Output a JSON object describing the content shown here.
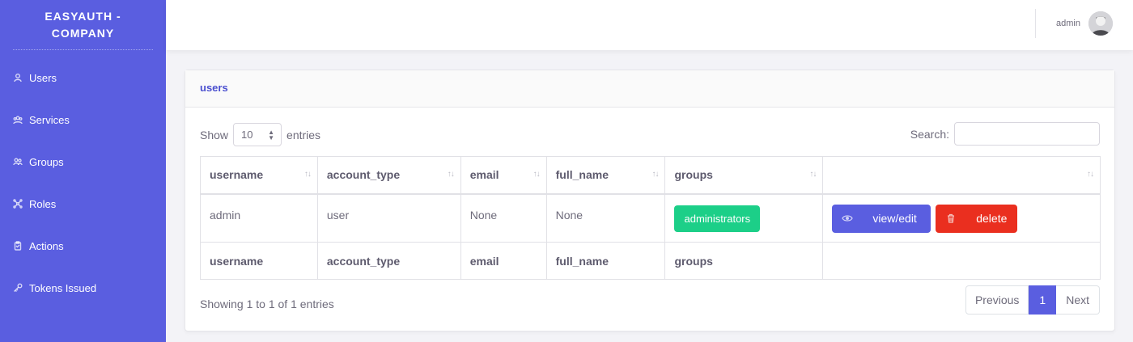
{
  "sidebar": {
    "brand": "EASYAUTH - COMPANY",
    "items": [
      {
        "label": "Users",
        "icon": "user-icon"
      },
      {
        "label": "Services",
        "icon": "services-icon"
      },
      {
        "label": "Groups",
        "icon": "groups-icon"
      },
      {
        "label": "Roles",
        "icon": "roles-icon"
      },
      {
        "label": "Actions",
        "icon": "actions-icon"
      },
      {
        "label": "Tokens Issued",
        "icon": "key-icon"
      }
    ],
    "color": "#5a5ee0"
  },
  "topbar": {
    "username": "admin"
  },
  "card": {
    "title": "users",
    "show_label": "Show",
    "entries_value": "10",
    "entries_label": "entries",
    "search_label": "Search:",
    "search_value": "",
    "columns": [
      "username",
      "account_type",
      "email",
      "full_name",
      "groups",
      ""
    ],
    "rows": [
      {
        "username": "admin",
        "account_type": "user",
        "email": "None",
        "full_name": "None",
        "groups": "administrators",
        "view_label": "view/edit",
        "delete_label": "delete"
      }
    ],
    "footer_columns": [
      "username",
      "account_type",
      "email",
      "full_name",
      "groups",
      ""
    ],
    "info": "Showing 1 to 1 of 1 entries",
    "pager": {
      "previous": "Previous",
      "page": "1",
      "next": "Next"
    }
  },
  "colors": {
    "accent": "#5a5ee0",
    "success": "#1ccf88",
    "danger": "#ea2f1f"
  }
}
